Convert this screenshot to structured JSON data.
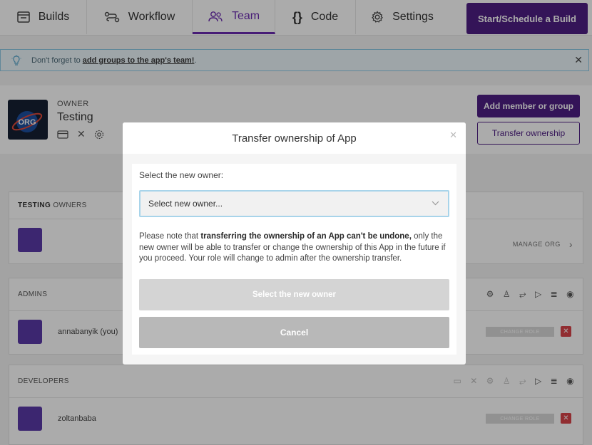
{
  "nav": {
    "tabs": [
      {
        "label": "Builds",
        "icon": "builds-icon"
      },
      {
        "label": "Workflow",
        "icon": "workflow-icon"
      },
      {
        "label": "Team",
        "icon": "team-icon",
        "active": true
      },
      {
        "label": "Code",
        "icon": "code-icon"
      },
      {
        "label": "Settings",
        "icon": "gear-icon"
      }
    ],
    "start_button": "Start/Schedule a Build"
  },
  "banner": {
    "text": "Don't forget to",
    "link": "add groups to the app's team!",
    "suffix": "."
  },
  "owner": {
    "label": "OWNER",
    "name": "Testing",
    "logo_text": "ORG",
    "add_member_button": "Add member or group",
    "transfer_button": "Transfer ownership"
  },
  "groups": {
    "owners": {
      "title_bold": "TESTING",
      "title_rest": "OWNERS",
      "manage_link": "MANAGE ORG"
    },
    "admins": {
      "title": "ADMINS",
      "members": [
        {
          "name": "annabanyik (you)",
          "role_button": "CHANGE ROLE"
        }
      ]
    },
    "developers": {
      "title": "DEVELOPERS",
      "members": [
        {
          "name": "zoltanbaba",
          "role_button": "CHANGE ROLE"
        }
      ]
    }
  },
  "modal": {
    "title": "Transfer ownership of App",
    "select_label": "Select the new owner:",
    "select_placeholder": "Select new owner...",
    "note_prefix": "Please note that",
    "note_bold": "transferring the ownership of an App can't be undone,",
    "note_rest": "only the new owner will be able to transfer or change the ownership of this App in the future if you proceed. Your role will change to admin after the ownership transfer.",
    "confirm_button": "Select the new owner",
    "cancel_button": "Cancel"
  },
  "colors": {
    "brand": "#4e1f83",
    "accent": "#6b2bb0",
    "danger": "#d9434a"
  }
}
